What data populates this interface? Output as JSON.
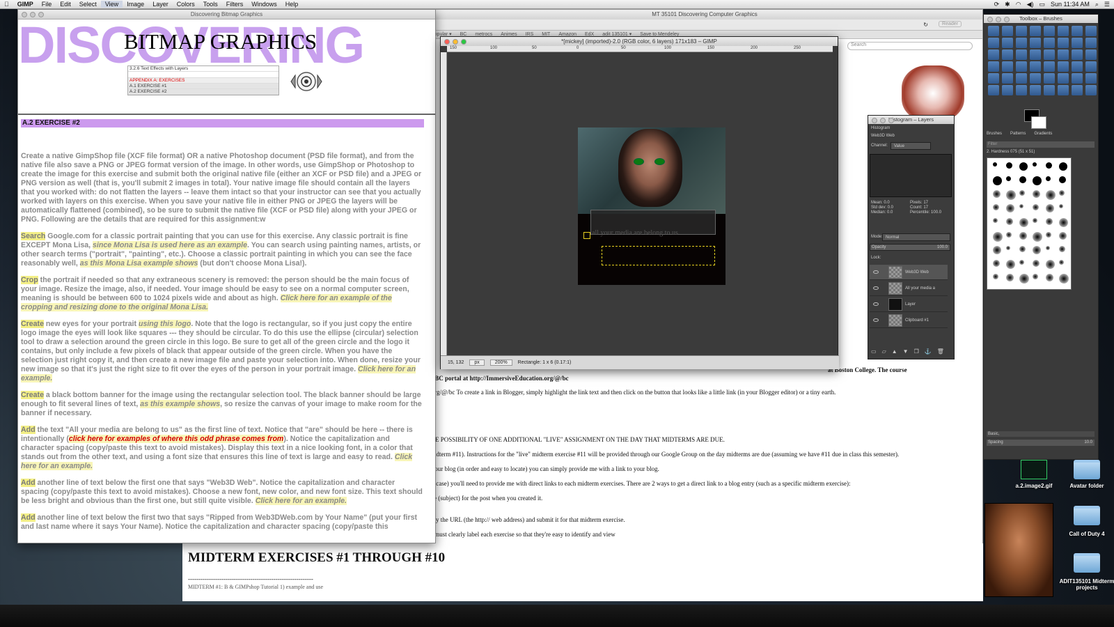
{
  "menubar": {
    "app": "GIMP",
    "items": [
      "File",
      "Edit",
      "Select",
      "View",
      "Image",
      "Layer",
      "Colors",
      "Tools",
      "Filters",
      "Windows",
      "Help"
    ],
    "clock": "Sun 11:34 AM"
  },
  "browser": {
    "title": "MT 35101 Discovering Computer Graphics",
    "reader": "Reader",
    "search": "Search",
    "bookmarks": [
      "Popular ▾",
      "BC",
      "metrocs",
      "Animes",
      "IRS",
      "MIT",
      "Amazon",
      "EdX",
      "adit 135101 ▾",
      "Save to Mendeley"
    ],
    "lines": [
      "at Boston College. The course",
      "he BC portal at http://ImmersiveEducation.org/@/bc",
      "n.org/@/bc  To create a link in Blogger, simply highlight the link text and then click on the button that looks like a little link (in your Blogger editor) or a tiny earth.",
      "THE POSSIBILITY OF ONE ADDITIONAL \"LIVE\" ASSIGNMENT ON THE DAY THAT MIDTERMS ARE DUE.",
      "(Midterm #11). Instructions for the \"live\" midterm exercise #11 will be provided through our Google Group on the day midterms are due (assuming we have #11 due in class this semester).",
      "n your blog (in order and easy to locate) you can simply provide me with a link to your blog.",
      "the case) you'll need to provide me with direct links to each midterm exercises. There are 2 ways to get a direct link to a blog entry (such as a specific midterm exercise):",
      "title (subject) for the post when you created it.",
      "copy the URL (the http:// web address) and submit it for that midterm exercise.",
      "ou must clearly label each exercise so that they're easy to identify and view"
    ],
    "midterm_heading": "MIDTERM EXERCISES #1 THROUGH #10",
    "dashes": "------------------------------------------------------------",
    "partial_line": "MIDTERM #1: B & GIMPshop Tutorial 1) example and use"
  },
  "doc": {
    "window_title": "Discovering Bitmap Graphics",
    "discovering": "DISCOVERING",
    "bitmap": "BITMAP GRAPHICS",
    "nav": [
      "3.2.6 Text Effects with Layers",
      "",
      "APPENDIX A: EXERCISES",
      "A.1 EXERCISE #1",
      "A.2 EXERCISE #2"
    ],
    "exercise_heading": "A.2 EXERCISE #2",
    "p1": "Create a native GimpShop file (XCF file format) OR a native Photoshop document (PSD file format), and from the native file also save a PNG or JPEG format version of the image. In other words, use GimpShop or Photoshop to create the image for this exercise and submit both the original native file (either an XCF or PSD file) and a JPEG or PNG version as well (that is, you'll submit 2 images in total). Your native image file should contain all the layers that you worked with: do not flatten the layers -- leave them intact so that your instructor can see that you actually worked with layers on this exercise. When you save your native file in either PNG or JPEG the layers will be automatically flattened (combined), so be sure to submit the native file (XCF or PSD file) along with your JPEG or PNG. Following are the details that are required for this assignment:w",
    "p2": {
      "verb": "Search",
      "a": " Google.com for a classic portrait painting that you can use for this exercise. Any classic portrait is fine EXCEPT Mona Lisa, ",
      "it1": "since Mona Lisa is used here as an example",
      "b": ". You can search using painting names, artists, or other search terms (\"portrait\", \"painting\", etc.). Choose a classic portrait painting in which you can see the face reasonably well, ",
      "it2": "as this Mona Lisa example shows",
      "c": " (but don't choose Mona Lisa!)."
    },
    "p3": {
      "verb": "Crop",
      "a": " the portrait if needed so that any extraneous scenery is removed: the person should be the main focus of your image. Resize the image, also, if needed. Your image should be easy to see on a normal computer screen, meaning is should be between 600 to 1024 pixels wide and about as high.  ",
      "it1": "Click here for an example of the cropping and resizing done to the original Mona Lisa."
    },
    "p4": {
      "verb": "Create",
      "a": " new eyes for your portrait ",
      "it1": "using this logo",
      "b": ". Note that the logo is rectangular, so if you just copy the entire logo image the eyes will look like squares --- they should be circular. To do this use the ellipse (circular) selection tool to draw a selection around the green circle in this logo. Be sure to get all of the green circle and the logo it contains, but only include a few pixels of black that appear outside of the green circle. When you have the selection just right copy it, and then create a new image file and paste your selection into. When done, resize your new image so that it's just the right size to fit over the eyes of the person in your portrait image.  ",
      "it2": "Click here for an example."
    },
    "p5": {
      "verb": "Create",
      "a": " a black bottom banner for the image using the rectangular selection tool. The black banner should be large enough to fit several lines of text, ",
      "it1": "as this example shows",
      "b": ", so resize the canvas of your image to make room for the banner if necessary."
    },
    "p6": {
      "verb": "Add",
      "a": " the text \"All your media are belong to us\" as the first line of text. Notice that \"are\" should be here -- there is intentionally (",
      "red": "click here for examples of where this odd phrase comes from",
      "b": "). Notice the capitalization and character spacing (copy/paste this text to avoid mistakes). Display this text in a nice looking font, in a color that stands out from the other text, and using a font size that ensures this line of text is large and easy to read.  ",
      "it1": "Click here for an example."
    },
    "p7": {
      "verb": "Add",
      "a": " another line of text below the first one that says \"Web3D Web\".  Notice the capitalization and character spacing (copy/paste this text to avoid mistakes). Choose a new font, new color, and new font size. This text should be less bright and obvious than the first one, but still quite visible.  ",
      "it1": "Click here for an example."
    },
    "p8": {
      "verb": "Add",
      "a": " another line of text below the first two that says \"Ripped from Web3DWeb.com by Your Name\" (put your first and last name where it says Your Name). Notice the capitalization and character spacing (copy/paste this"
    }
  },
  "gimp": {
    "window_title": "*[mickey] (imported)-2.0 (RGB color, 6 layers) 171x183 – GIMP",
    "ruler": [
      "150",
      "100",
      "50",
      "0",
      "50",
      "100",
      "150",
      "200",
      "250"
    ],
    "canvas_text": "all your media are belong to us",
    "coords": "15, 132",
    "unit": "px",
    "zoom": "200%",
    "status": "Rectangle: 1 x 6  (0.17:1)"
  },
  "dock": {
    "title": "Histogram – Layers",
    "tab": "Histogram",
    "subtitle": "Web3D Web",
    "channel_label": "Channel:",
    "channel_value": "Value",
    "stats": [
      "Mean: 0.0",
      "Std dev: 0.0",
      "Median: 0.0",
      "Pixels: 17",
      "Count: 17",
      "Percentile: 100.0"
    ],
    "mode_label": "Mode:",
    "mode_value": "Normal",
    "opacity_label": "Opacity",
    "opacity_value": "100.0",
    "lock_label": "Lock:",
    "layers": [
      "Web3D Web",
      "All your media a",
      "Layer",
      "Clipboard #1"
    ]
  },
  "toolbox": {
    "title": "Toolbox – Brushes",
    "tabs": [
      "Brushes",
      "Patterns",
      "Gradients"
    ],
    "filter": "Filter",
    "brush_name": "2. Hardness 075 (51 x 51)",
    "preset": "Basic,",
    "spacing_label": "Spacing",
    "spacing_value": "10.0"
  },
  "desktop": {
    "icons": [
      {
        "label": "a.2.image2.gif"
      },
      {
        "label": "Avatar folder"
      },
      {
        "label": "Call of Duty 4"
      },
      {
        "label": "ADIT135101 Midterm projects"
      }
    ]
  }
}
